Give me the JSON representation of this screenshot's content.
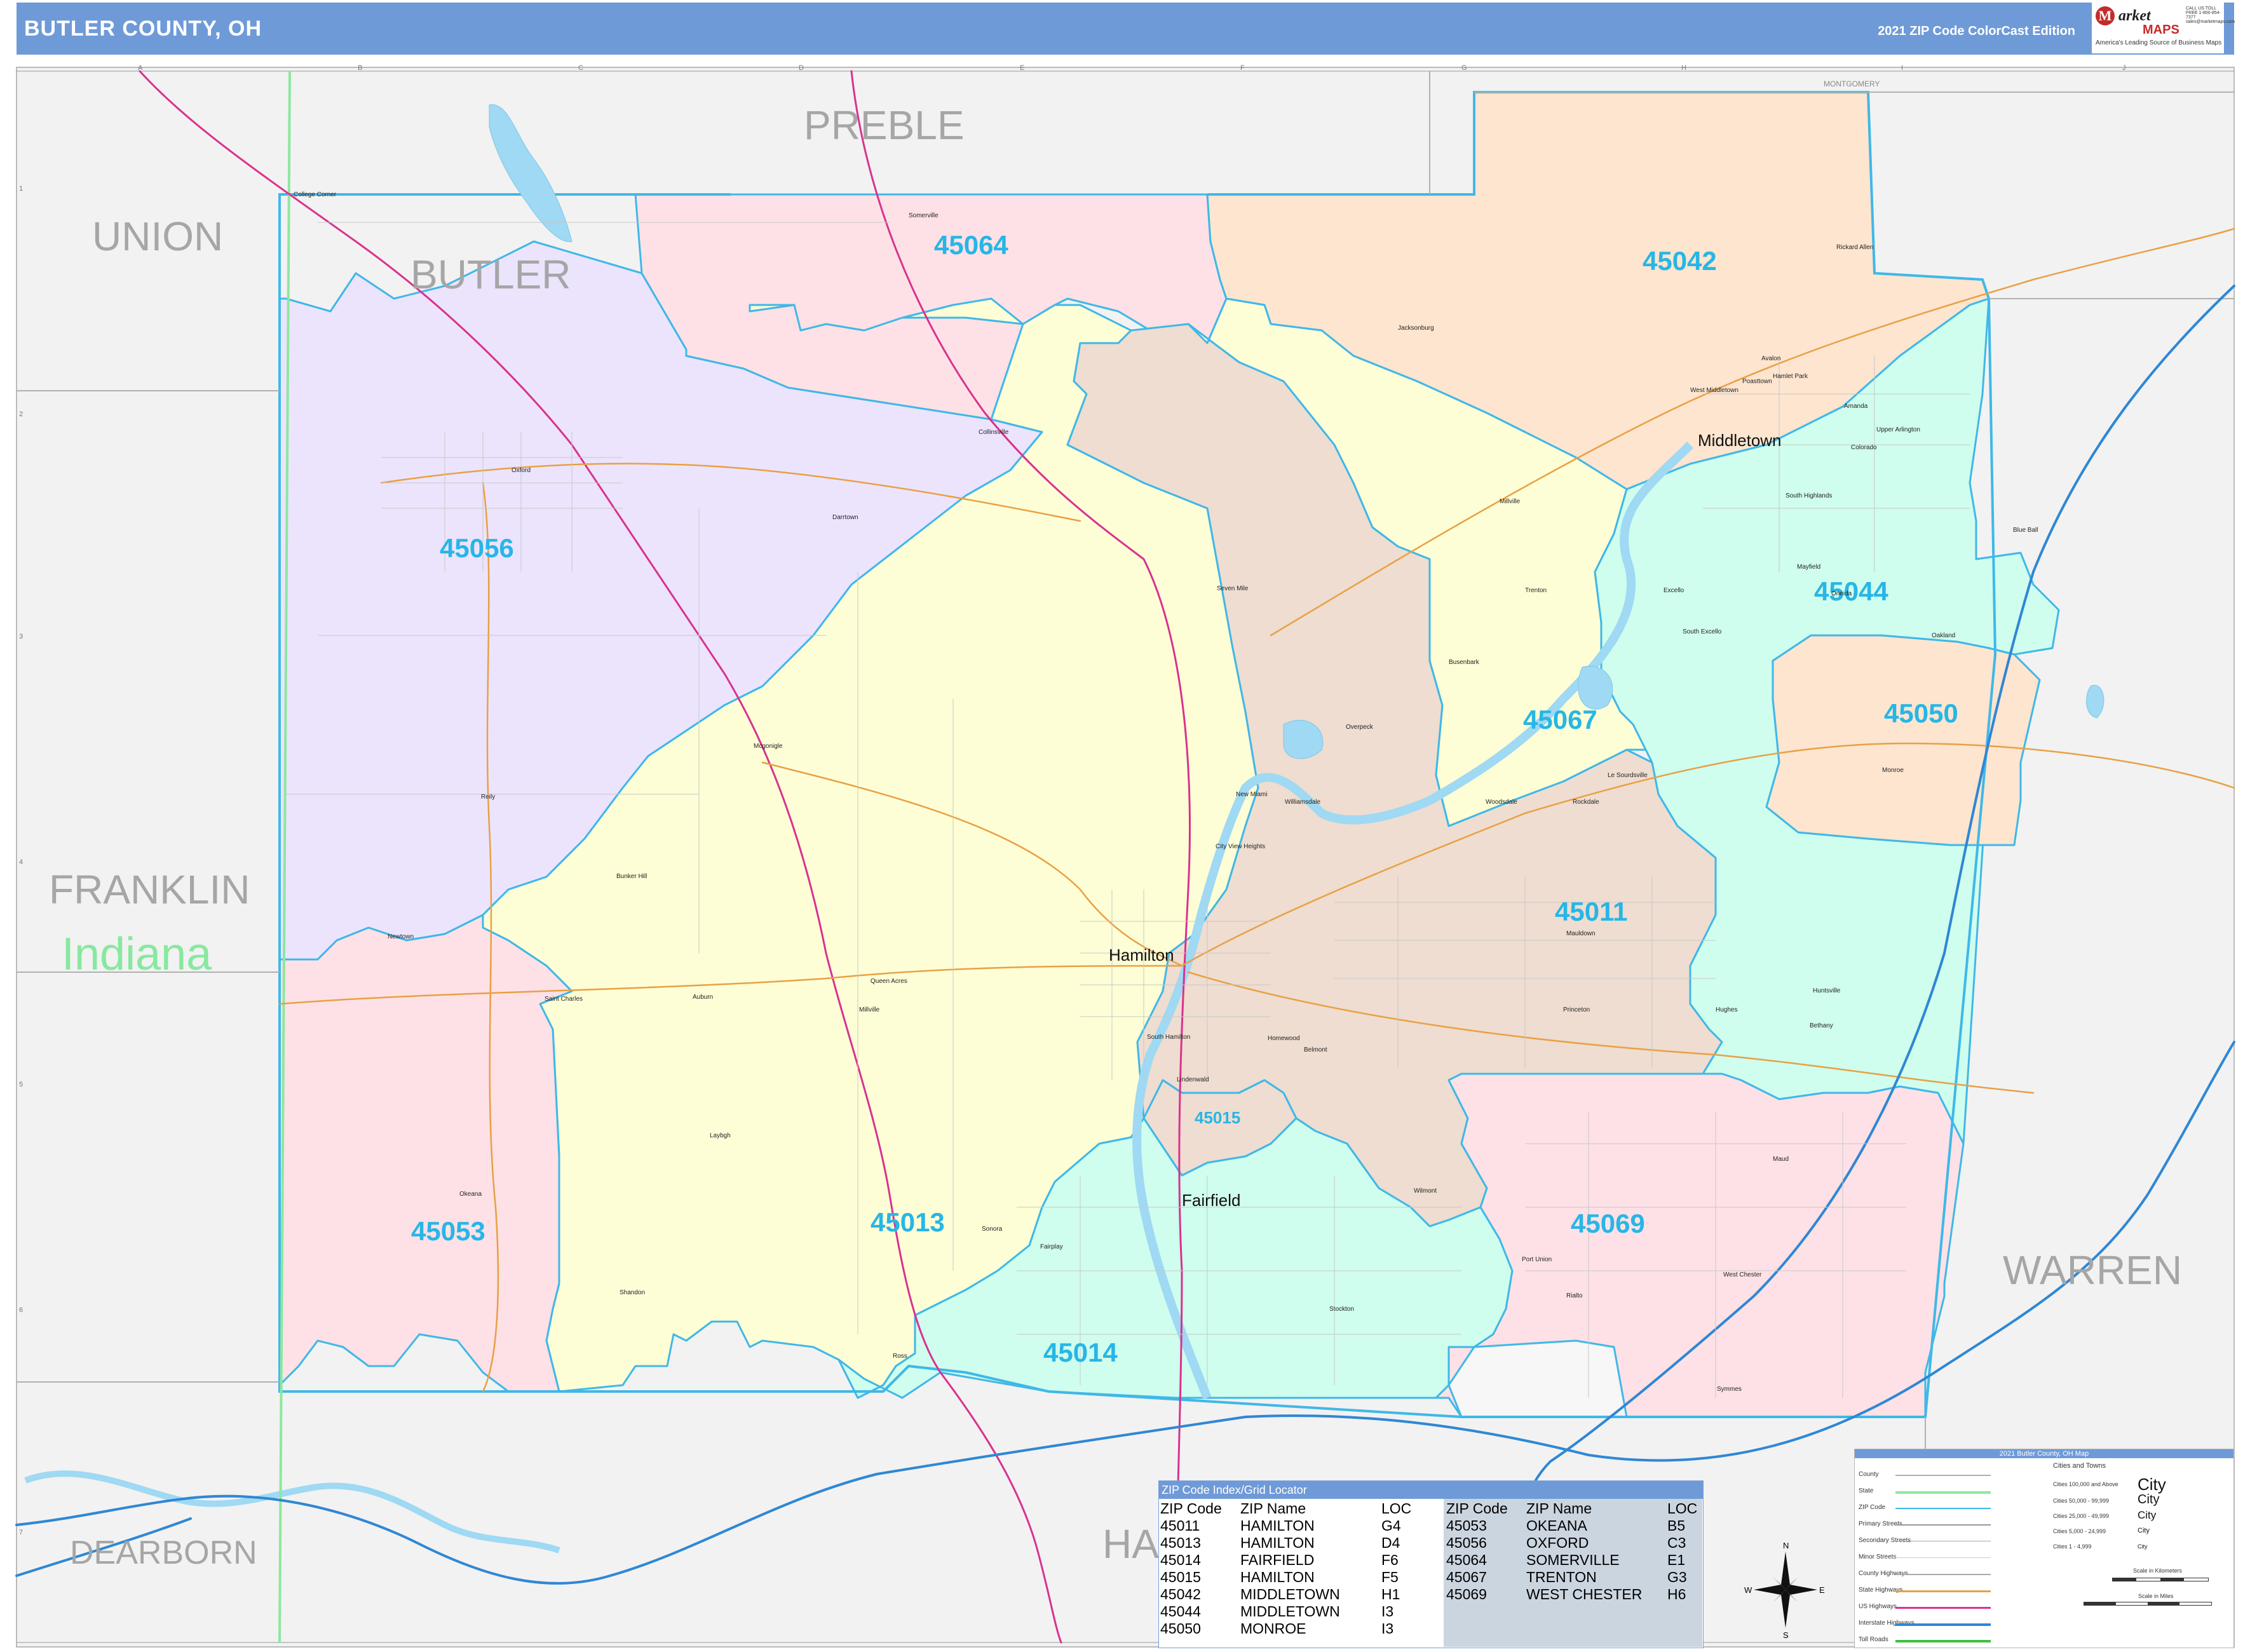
{
  "header": {
    "title": "BUTLER COUNTY, OH",
    "edition": "2021 ZIP Code ColorCast Edition",
    "logo": {
      "brand": "arket",
      "brand_initial": "M",
      "maps": "MAPS",
      "slogan": "America's Leading Source of Business Maps",
      "phone": "CALL US TOLL FREE 1-800-854-7377 sales@marketmaps.com"
    }
  },
  "colors": {
    "zip_45056": "#ece4fd",
    "zip_45064": "#fde1e6",
    "zip_45042": "#fde5cf",
    "zip_45013": "#fefed6",
    "zip_45011": "#eeddd0",
    "zip_45044": "#cffdee",
    "zip_45050": "#fde5cf",
    "zip_45067": "#fefed6",
    "zip_45053": "#fde1e6",
    "zip_45014": "#cffdee",
    "zip_45069": "#fde1e6",
    "zip_45015": "#eeddd0",
    "zip_border": "#3fb8e8",
    "outside": "#f2f2f2",
    "water": "#9fd9f3",
    "interstate": "#2f87d4",
    "us_highway": "#d9328f",
    "state_highway": "#e9a043",
    "state_line": "#8ce89e",
    "header": "#6f9ad8"
  },
  "map": {
    "neighbors": [
      {
        "name": "PREBLE"
      },
      {
        "name": "UNION"
      },
      {
        "name": "BUTLER"
      },
      {
        "name": "FRANKLIN"
      },
      {
        "name": "DEARBORN"
      },
      {
        "name": "WARREN"
      },
      {
        "name": "HA"
      }
    ],
    "state_label": "Indiana",
    "zip_labels": [
      "45064",
      "45042",
      "45056",
      "45044",
      "45067",
      "45050",
      "45011",
      "45015",
      "45013",
      "45053",
      "45069",
      "45014"
    ],
    "major_cities": [
      "Middletown",
      "Hamilton",
      "Fairfield"
    ],
    "small_places": [
      "College Corner",
      "Somerville",
      "Jacksonburg",
      "Oxford",
      "Collinsville",
      "Darrtown",
      "Millville",
      "Seven Mile",
      "Trenton",
      "Excello",
      "South Excello",
      "Busenbark",
      "Overpeck",
      "Woodsdale",
      "Rockdale",
      "Le Sourdsville",
      "Monroe",
      "Mayfield",
      "Oneida",
      "Poasttown",
      "Rickard Allen",
      "Avalon",
      "West Middletown",
      "Hamlet Park",
      "Upper Arlington",
      "Colorado",
      "South Highlands",
      "Blue Ball",
      "Amanda",
      "Oakland",
      "Mcgonigle",
      "Reily",
      "Bunker Hill",
      "Newtown",
      "Auburn",
      "Queen Acres",
      "Saint Charles",
      "Millville",
      "Laybgh",
      "Okeana",
      "Shandon",
      "Ross",
      "Fairplay",
      "Stockton",
      "Port Union",
      "Rialto",
      "West Chester",
      "Symmes",
      "Maud",
      "Bethany",
      "Huntsville",
      "Mauldown",
      "Princeton",
      "Hughes",
      "City View Heights",
      "New Miami",
      "Williamsdale",
      "South Hamilton",
      "Lindenwald",
      "Homewood",
      "Belmont",
      "Sonora",
      "Wilmont"
    ],
    "grid_cols": [
      "A",
      "B",
      "C",
      "D",
      "E",
      "F",
      "G",
      "H",
      "I",
      "J"
    ],
    "grid_rows": [
      "1",
      "2",
      "3",
      "4",
      "5",
      "6",
      "7"
    ],
    "top_road_label": "MONTGOMERY"
  },
  "zip_index": {
    "title": "ZIP Code Index/Grid Locator",
    "headers": [
      "ZIP Code",
      "ZIP Name",
      "LOC"
    ],
    "left": [
      {
        "zip": "45011",
        "name": "HAMILTON",
        "loc": "G4"
      },
      {
        "zip": "45013",
        "name": "HAMILTON",
        "loc": "D4"
      },
      {
        "zip": "45014",
        "name": "FAIRFIELD",
        "loc": "F6"
      },
      {
        "zip": "45015",
        "name": "HAMILTON",
        "loc": "F5"
      },
      {
        "zip": "45042",
        "name": "MIDDLETOWN",
        "loc": "H1"
      },
      {
        "zip": "45044",
        "name": "MIDDLETOWN",
        "loc": "I3"
      },
      {
        "zip": "45050",
        "name": "MONROE",
        "loc": "I3"
      }
    ],
    "right": [
      {
        "zip": "45053",
        "name": "OKEANA",
        "loc": "B5"
      },
      {
        "zip": "45056",
        "name": "OXFORD",
        "loc": "C3"
      },
      {
        "zip": "45064",
        "name": "SOMERVILLE",
        "loc": "E1"
      },
      {
        "zip": "45067",
        "name": "TRENTON",
        "loc": "G3"
      },
      {
        "zip": "45069",
        "name": "WEST CHESTER",
        "loc": "H6"
      }
    ]
  },
  "legend": {
    "title": "2021 Butler County, OH Map",
    "rows": [
      "County",
      "State",
      "ZIP Code",
      "Primary Streets",
      "Secondary Streets",
      "Minor Streets",
      "County Highways",
      "State Highways",
      "US Highways",
      "Interstate Highways",
      "Toll Roads"
    ],
    "cities_heading": "Cities and Towns",
    "cities": [
      {
        "range": "Cities 100,000 and Above",
        "sample": "City"
      },
      {
        "range": "Cities 50,000 - 99,999",
        "sample": "City"
      },
      {
        "range": "Cities 25,000 - 49,999",
        "sample": "City"
      },
      {
        "range": "Cities 5,000 - 24,999",
        "sample": "City"
      },
      {
        "range": "Cities 1 - 4,999",
        "sample": "City"
      }
    ],
    "scale_km": "Scale in Kilometers",
    "scale_mi": "Scale in Miles"
  },
  "compass": {
    "n": "N",
    "s": "S",
    "e": "E",
    "w": "W"
  }
}
